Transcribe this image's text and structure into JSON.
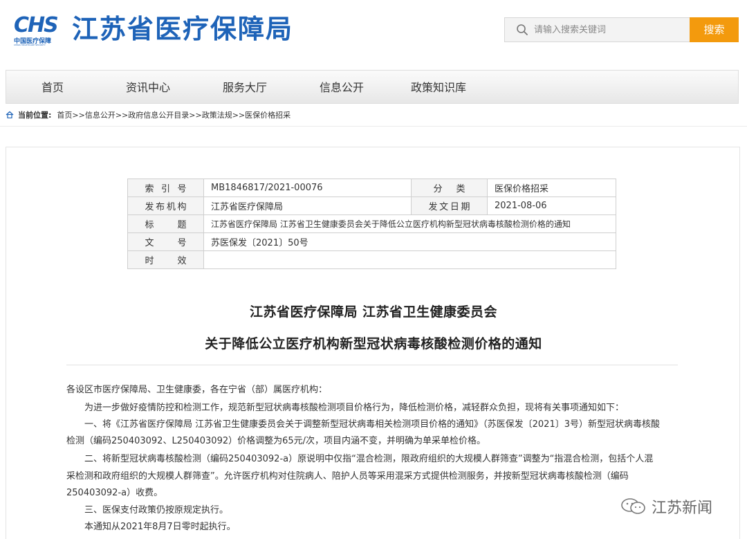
{
  "header": {
    "logo_abbr": "CHS",
    "logo_cn": "中国医疗保障",
    "logo_en": "CHINA HEALTHCARE SECURITY",
    "site_title": "江苏省医疗保障局",
    "search_placeholder": "请输入搜索关键词",
    "search_button": "搜索"
  },
  "nav": {
    "items": [
      "首页",
      "资讯中心",
      "服务大厅",
      "信息公开",
      "政策知识库"
    ]
  },
  "breadcrumb": {
    "label": "当前位置:",
    "path": "首页>>信息公开>>政府信息公开目录>>政策法规>>医保价格招采"
  },
  "meta": {
    "index_label": "索 引 号",
    "index_value": "MB1846817/2021-00076",
    "category_label": "分 类",
    "category_value": "医保价格招采",
    "publisher_label": "发布机构",
    "publisher_value": "江苏省医疗保障局",
    "date_label": "发文日期",
    "date_value": "2021-08-06",
    "title_label": "标 题",
    "title_value": "江苏省医疗保障局 江苏省卫生健康委员会关于降低公立医疗机构新型冠状病毒核酸检测价格的通知",
    "docno_label": "文 号",
    "docno_value": "苏医保发〔2021〕50号",
    "validity_label": "时 效",
    "validity_value": ""
  },
  "document": {
    "title_line1": "江苏省医疗保障局 江苏省卫生健康委员会",
    "title_line2": "关于降低公立医疗机构新型冠状病毒核酸检测价格的通知",
    "salutation": "各设区市医疗保障局、卫生健康委，各在宁省（部）属医疗机构：",
    "para1": "为进一步做好疫情防控和检测工作，规范新型冠状病毒核酸检测项目价格行为，降低检测价格，减轻群众负担，现将有关事项通知如下：",
    "para2_line1": "一、将《江苏省医疗保障局 江苏省卫生健康委员会关于调整新型冠状病毒相关检测项目价格的通知》（苏医保发〔2021〕3号）新型冠状病毒核酸",
    "para2_line2": "检测（编码250403092、L250403092）价格调整为65元/次，项目内涵不变，并明确为单采单检价格。",
    "para3_line1": "二、将新型冠状病毒核酸检测（编码250403092-a）原说明中仅指“混合检测，限政府组织的大规模人群筛查”调整为“指混合检测，包括个人混",
    "para3_line2": "采检测和政府组织的大规模人群筛查”。允许医疗机构对住院病人、陪护人员等采用混采方式提供检测服务，并按新型冠状病毒核酸检测（编码",
    "para3_line3": "250403092-a）收费。",
    "para4": "三、医保支付政策仍按原规定执行。",
    "para5": "本通知从2021年8月7日零时起执行。"
  },
  "watermark": {
    "text": "江苏新闻"
  },
  "colors": {
    "brand_blue": "#1e63b8",
    "search_orange": "#f39a0d"
  }
}
